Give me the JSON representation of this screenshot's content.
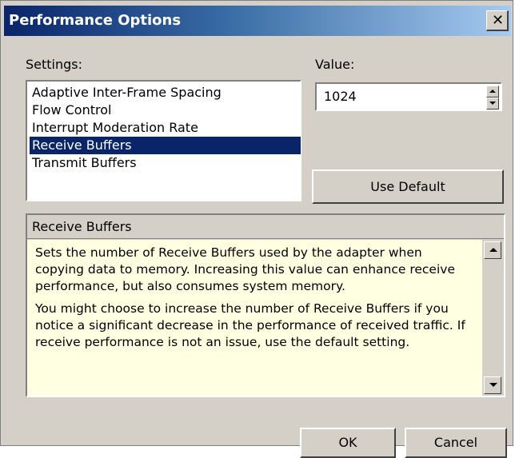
{
  "window": {
    "title": "Performance Options",
    "close_glyph": "✕"
  },
  "settings": {
    "label": "Settings:",
    "items": [
      {
        "label": "Adaptive Inter-Frame Spacing",
        "selected": false
      },
      {
        "label": "Flow Control",
        "selected": false
      },
      {
        "label": "Interrupt Moderation Rate",
        "selected": false
      },
      {
        "label": "Receive Buffers",
        "selected": true
      },
      {
        "label": "Transmit Buffers",
        "selected": false
      }
    ]
  },
  "value": {
    "label": "Value:",
    "current": "1024"
  },
  "buttons": {
    "use_default": "Use Default",
    "ok": "OK",
    "cancel": "Cancel"
  },
  "description": {
    "header": "Receive Buffers",
    "paragraphs": [
      "Sets the number of Receive Buffers used by the adapter when copying data to memory. Increasing this value can enhance receive performance, but also consumes system memory.",
      "You might choose to increase the number of Receive Buffers if you notice a significant decrease in the performance of received traffic. If receive performance is not an issue, use the default setting."
    ]
  },
  "icons": {
    "close": "close-icon",
    "spin_up": "spin-up-arrow-icon",
    "spin_down": "spin-down-arrow-icon",
    "scroll_up": "scroll-up-arrow-icon",
    "scroll_down": "scroll-down-arrow-icon"
  },
  "colors": {
    "title_gradient_start": "#0a246a",
    "title_gradient_end": "#a6caf0",
    "selection": "#0a246a",
    "info_background": "#ffffe1",
    "dialog_face": "#d4d0c8"
  }
}
